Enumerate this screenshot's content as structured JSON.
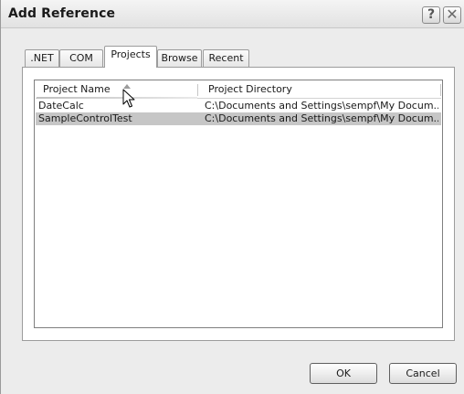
{
  "window": {
    "title": "Add Reference",
    "help_glyph": "?",
    "close_glyph": "✕"
  },
  "tabs": [
    {
      "label": ".NET",
      "selected": false
    },
    {
      "label": "COM",
      "selected": false
    },
    {
      "label": "Projects",
      "selected": true
    },
    {
      "label": "Browse",
      "selected": false
    },
    {
      "label": "Recent",
      "selected": false
    }
  ],
  "list": {
    "columns": [
      "Project Name",
      "Project Directory"
    ],
    "rows": [
      {
        "name": "DateCalc",
        "directory": "C:\\Documents and Settings\\sempf\\My Docum...",
        "selected": false
      },
      {
        "name": "SampleControlTest",
        "directory": "C:\\Documents and Settings\\sempf\\My Docum...",
        "selected": true
      }
    ]
  },
  "buttons": {
    "ok": "OK",
    "cancel": "Cancel"
  },
  "icons": {
    "help": "help-icon",
    "close": "close-icon",
    "sort": "sort-ascending-icon",
    "cursor": "mouse-pointer-icon"
  },
  "colors": {
    "selected_row": "#c6c6c6",
    "dialog_bg": "#ececec"
  }
}
